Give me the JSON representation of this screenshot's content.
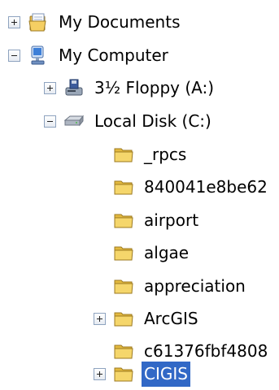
{
  "tree": {
    "items": [
      {
        "label": "My Documents",
        "expander": "plus",
        "icon": "my-documents-icon"
      },
      {
        "label": "My Computer",
        "expander": "minus",
        "icon": "my-computer-icon"
      },
      {
        "label": "3½ Floppy (A:)",
        "expander": "plus",
        "icon": "floppy-drive-icon"
      },
      {
        "label": "Local Disk (C:)",
        "expander": "minus",
        "icon": "hard-disk-icon"
      },
      {
        "label": "_rpcs",
        "expander": null,
        "icon": "folder-icon"
      },
      {
        "label": "840041e8be62",
        "expander": null,
        "icon": "folder-icon"
      },
      {
        "label": "airport",
        "expander": null,
        "icon": "folder-icon"
      },
      {
        "label": "algae",
        "expander": null,
        "icon": "folder-icon"
      },
      {
        "label": "appreciation",
        "expander": null,
        "icon": "folder-icon"
      },
      {
        "label": "ArcGIS",
        "expander": "plus",
        "icon": "folder-icon"
      },
      {
        "label": "c61376fbf4808",
        "expander": null,
        "icon": "folder-icon"
      },
      {
        "label": "CIGIS",
        "expander": "plus",
        "icon": "folder-icon",
        "selected": true
      }
    ]
  },
  "colors": {
    "selection": "#3168c6",
    "folder": "#f5d66b"
  }
}
